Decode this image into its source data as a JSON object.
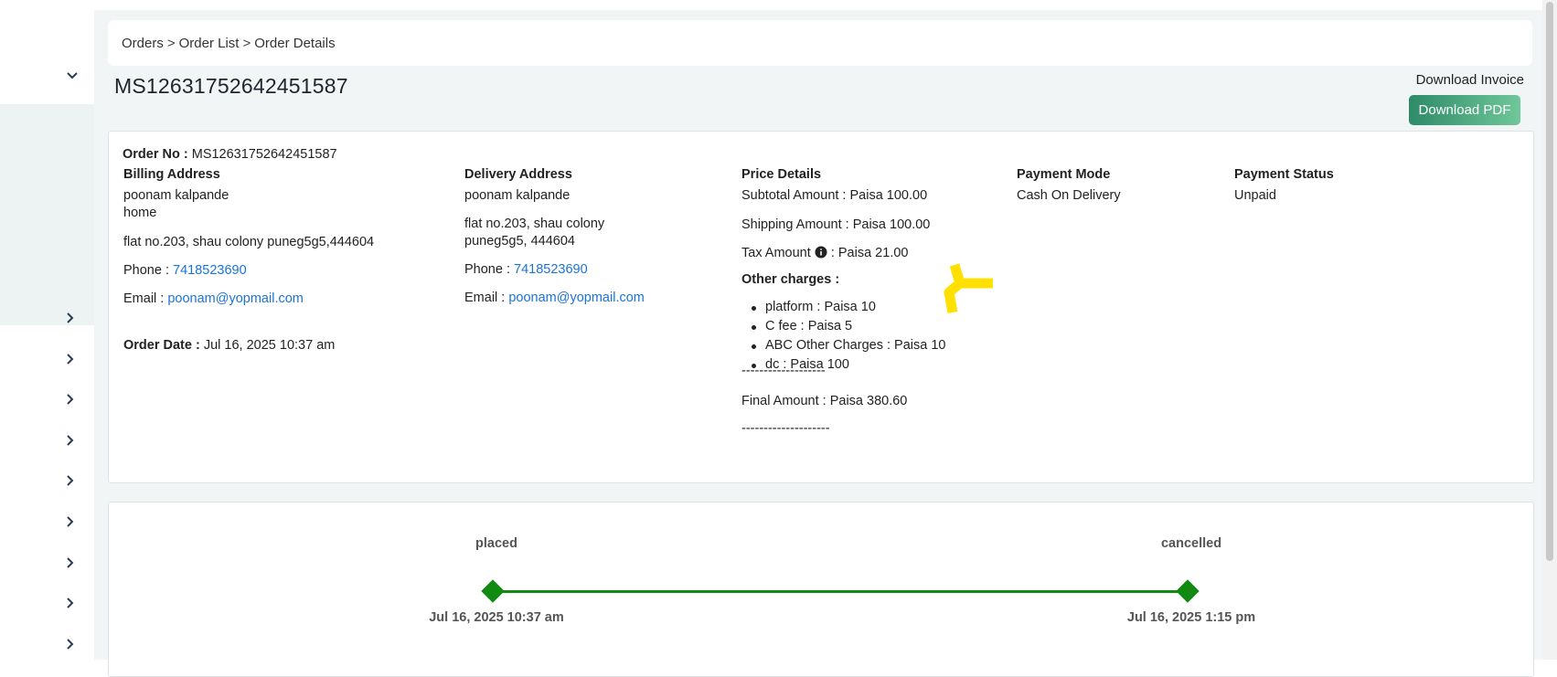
{
  "breadcrumb": {
    "items": [
      "Orders",
      "Order List",
      "Order Details"
    ],
    "separator": ">"
  },
  "order_title": "MS12631752642451587",
  "invoice": {
    "label": "Download Invoice",
    "button": "Download PDF"
  },
  "order": {
    "order_no_label": "Order No :",
    "order_no": "MS12631752642451587",
    "order_date_label": "Order Date :",
    "order_date": "Jul 16, 2025 10:37 am"
  },
  "billing": {
    "heading": "Billing Address",
    "name": "poonam kalpande",
    "type": "home",
    "address": "flat no.203, shau colony puneg5g5,444604",
    "phone_label": "Phone :",
    "phone": "7418523690",
    "email_label": "Email :",
    "email": "poonam@yopmail.com"
  },
  "delivery": {
    "heading": "Delivery Address",
    "name": "poonam kalpande",
    "address_line1": "flat no.203, shau colony",
    "address_line2": "puneg5g5, 444604",
    "phone_label": "Phone :",
    "phone": "7418523690",
    "email_label": "Email :",
    "email": "poonam@yopmail.com"
  },
  "price": {
    "heading": "Price Details",
    "subtotal": "Subtotal Amount : Paisa 100.00",
    "shipping": "Shipping Amount : Paisa 100.00",
    "tax_label": "Tax Amount",
    "tax_value": ": Paisa  21.00",
    "other_heading": "Other charges :",
    "other_items": [
      "platform :  Paisa  10",
      "C fee :  Paisa  5",
      "ABC Other Charges :  Paisa  10",
      "dc :  Paisa  100"
    ],
    "divider1": "-------------------",
    "final": "Final Amount : Paisa  380.60",
    "divider2": "--------------------"
  },
  "payment_mode": {
    "heading": "Payment Mode",
    "value": "Cash On Delivery"
  },
  "payment_status": {
    "heading": "Payment Status",
    "value": "Unpaid"
  },
  "timeline": {
    "steps": [
      {
        "status": "placed",
        "date": "Jul 16, 2025 10:37 am"
      },
      {
        "status": "cancelled",
        "date": "Jul 16, 2025 1:15 pm"
      }
    ]
  },
  "colors": {
    "accent_green": "#118a11",
    "button_start": "#2e8b68",
    "button_end": "#6fc79a",
    "link": "#1a73d9",
    "annotation_arrow": "#ffe000"
  },
  "icons": {
    "sidebar_collapse": "chevron-down-icon",
    "sidebar_expand": "chevron-right-icon",
    "tax_info": "info-icon",
    "annotation": "arrow-left-icon"
  }
}
